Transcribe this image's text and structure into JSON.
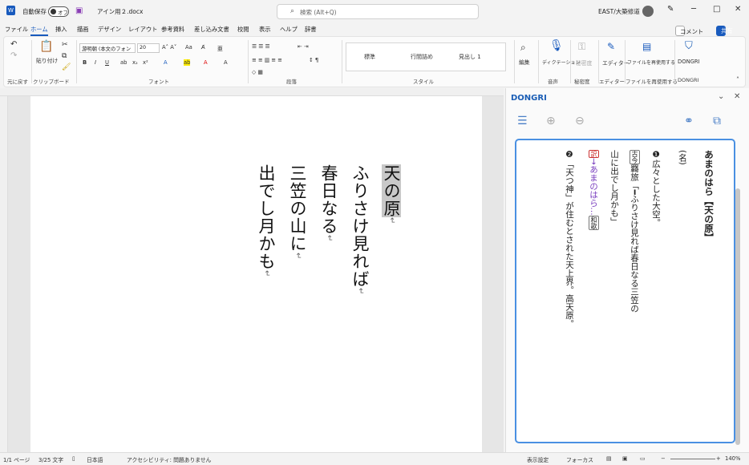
{
  "titlebar": {
    "autosave_label": "自動保存",
    "autosave_state": "オフ",
    "doc_title": "アイン用２.docx",
    "search_placeholder": "検索 (Alt+Q)",
    "user": "EAST/大築修道",
    "minimize": "─",
    "maximize": "□",
    "close": "✕"
  },
  "menu": {
    "items": [
      "ファイル",
      "ホーム",
      "挿入",
      "描画",
      "デザイン",
      "レイアウト",
      "参考資料",
      "差し込み文書",
      "校閲",
      "表示",
      "ヘルプ",
      "辞書"
    ],
    "comment_label": "コメント",
    "share_label": "共有"
  },
  "ribbon": {
    "groups": [
      "元に戻す",
      "クリップボード",
      "フォント",
      "段落",
      "スタイル",
      "音声",
      "秘密度",
      "エディター",
      "ファイルを再使用する",
      "DONGRI"
    ],
    "paste_label": "貼り付け",
    "font_name": "游明朝 (本文のフォン",
    "font_size": "20",
    "styles": [
      "標準",
      "行間詰め",
      "見出し 1"
    ],
    "edit_label": "編集",
    "dictate_label": "ディクテーション",
    "sensitivity_label": "秘密度",
    "editor_label": "エディター",
    "reuse_label": "ファイルを再使用する",
    "dongri_label": "DONGRI"
  },
  "document": {
    "lines": [
      "天の原",
      "ふりさけ見れば",
      "春日なる",
      "三笠の山に",
      "出でし月かも"
    ],
    "return_mark": "↵"
  },
  "pane": {
    "title": "DONGRI",
    "headword": "あまのはら【天の原】",
    "pos": "(名)",
    "sense1_num": "❶",
    "sense1": "広々とした大空。",
    "tag_kokin": "古今",
    "tag_genre": "羇旅",
    "quote1": "「━ふりさけ見れば春日なる三笠の",
    "quote2": "山に出でし月かも」",
    "tag_yaku": "訳",
    "arrow_text": "→あまのはら…",
    "tag_waka": "和歌",
    "sense2_num": "❷",
    "sense2": "「天つ神」が住むとされた天上界。高天原。"
  },
  "status": {
    "page": "1/1 ページ",
    "words": "3/25 文字",
    "lang": "日本語",
    "accessibility": "アクセシビリティ: 問題ありません",
    "display": "表示設定",
    "focus": "フォーカス",
    "zoom": "140%"
  },
  "colors": {
    "accent": "#185abd",
    "pane_border": "#4a90e2",
    "pane_title": "#1a5db5"
  }
}
